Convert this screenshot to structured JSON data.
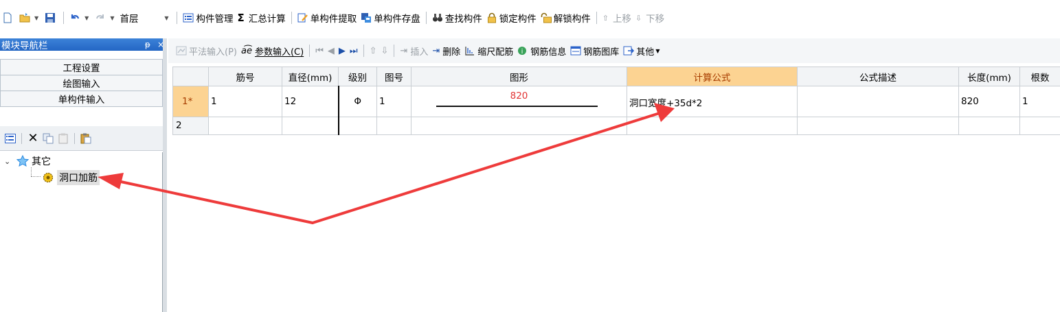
{
  "toolbar": {
    "floor_select": "首层",
    "buttons": {
      "component_management": "构件管理",
      "summary_calc": "汇总计算",
      "single_extract": "单构件提取",
      "single_save": "单构件存盘",
      "find": "查找构件",
      "lock": "锁定构件",
      "unlock": "解锁构件",
      "move_up": "上移",
      "move_down": "下移"
    },
    "sigma": "Σ"
  },
  "nav": {
    "title": "模块导航栏",
    "pin": "ᵽ",
    "close": "×",
    "buttons": [
      "工程设置",
      "绘图输入",
      "单构件输入"
    ],
    "tree": {
      "root": "其它",
      "child": "洞口加筋"
    }
  },
  "toolbar2": {
    "buttons": {
      "flat_input": "平法输入(P)",
      "param_input": "参数输入(C)",
      "insert": "插入",
      "delete": "删除",
      "scale_rebar": "缩尺配筋",
      "rebar_info": "钢筋信息",
      "rebar_library": "钢筋图库",
      "other": "其他"
    }
  },
  "grid": {
    "columns": [
      "",
      "筋号",
      "直径(mm)",
      "级别",
      "图号",
      "图形",
      "计算公式",
      "公式描述",
      "长度(mm)",
      "根数"
    ],
    "rows": [
      {
        "row_num": "1*",
        "bar_no": "1",
        "diameter": "12",
        "grade": "Φ",
        "figure_no": "1",
        "shape_value": "820",
        "formula": "洞口宽度+35d*2",
        "description": "",
        "length": "820",
        "count": "1"
      },
      {
        "row_num": "2",
        "bar_no": "",
        "diameter": "",
        "grade": "",
        "figure_no": "",
        "shape_value": "",
        "formula": "",
        "description": "",
        "length": "",
        "count": ""
      }
    ]
  },
  "colors": {
    "active_header_bg": "#fcd392",
    "annotation_arrow": "#ee3b3b",
    "shape_value": "#e13333",
    "nav_header": "#2e72cf"
  }
}
